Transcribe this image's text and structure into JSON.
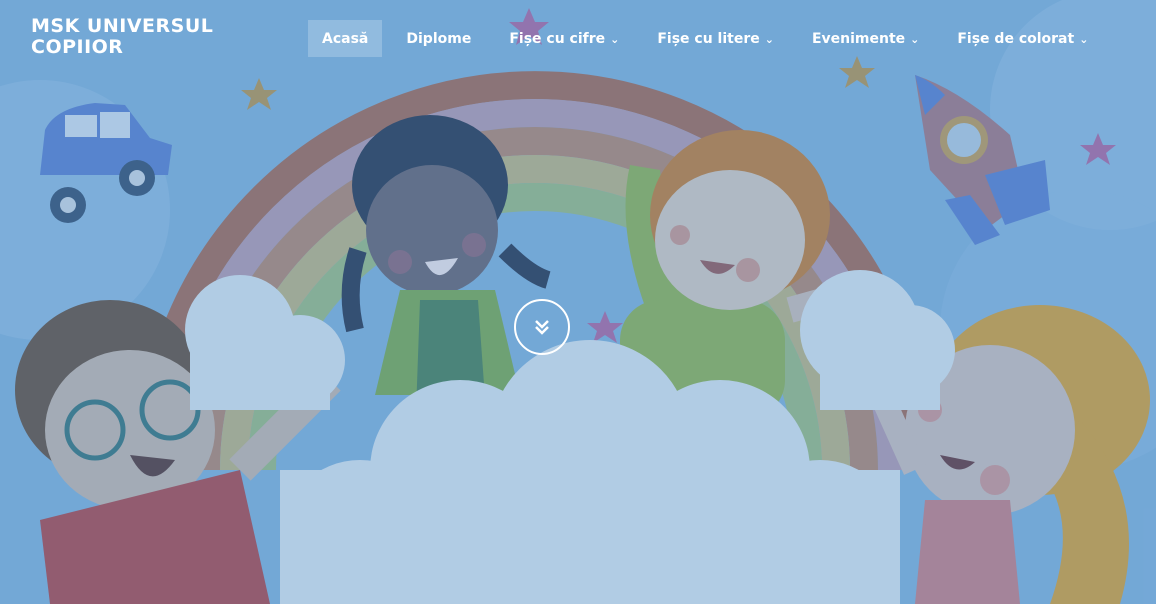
{
  "site": {
    "logo_line1": "MSK UNIVERSUL",
    "logo_line2": "COPIIOR"
  },
  "nav": {
    "items": [
      {
        "label": "Acasă",
        "active": true,
        "has_dropdown": false
      },
      {
        "label": "Diplome",
        "active": false,
        "has_dropdown": false
      },
      {
        "label": "Fișe cu cifre",
        "active": false,
        "has_dropdown": true
      },
      {
        "label": "Fișe cu litere",
        "active": false,
        "has_dropdown": true
      },
      {
        "label": "Evenimente",
        "active": false,
        "has_dropdown": true
      },
      {
        "label": "Fișe de colorat",
        "active": false,
        "has_dropdown": true
      }
    ]
  },
  "hero": {
    "scroll_icon": "double-chevron-down-icon"
  },
  "colors": {
    "sky": "#7fb0dc",
    "text": "#ffffff"
  }
}
